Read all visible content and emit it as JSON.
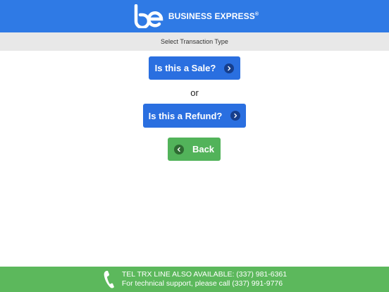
{
  "header": {
    "logo_text": "be",
    "brand_name": "BUSINESS EXPRESS",
    "brand_mark": "®",
    "color": "#2f7ae5"
  },
  "subheader": {
    "title": "Select Transaction Type"
  },
  "main": {
    "sale_label": "Is this a Sale?",
    "or_label": "or",
    "refund_label": "Is this a Refund?",
    "back_label": "Back",
    "primary_color": "#2a6fe0",
    "back_color": "#52b35a"
  },
  "footer": {
    "line1": "TEL TRX LINE ALSO AVAILABLE: (337) 981-6361",
    "line2": "For technical support, please call (337) 991-9776",
    "icon": "phone-icon",
    "color": "#5cb85c"
  }
}
